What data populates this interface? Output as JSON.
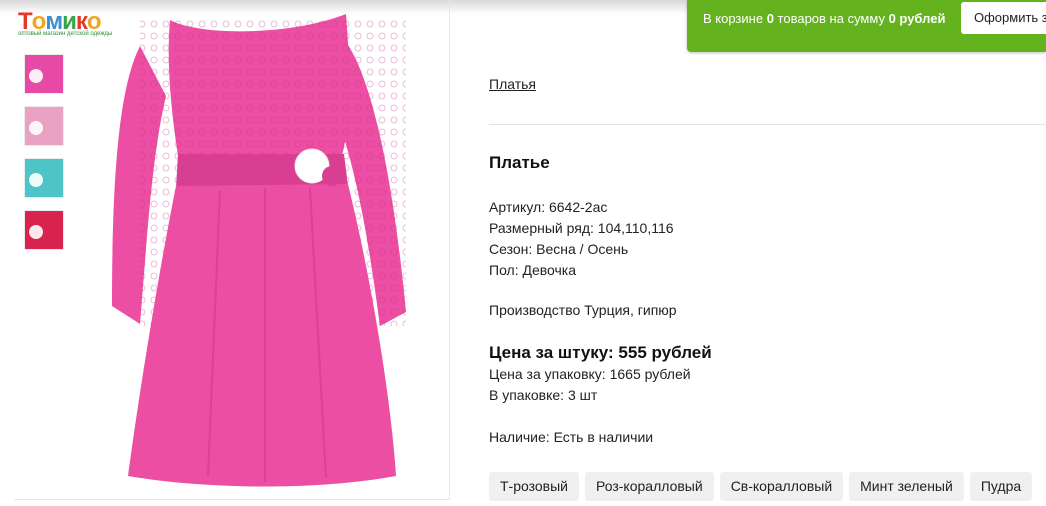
{
  "logo": {
    "letters": [
      "Т",
      "о",
      "м",
      "и",
      "к",
      "о"
    ],
    "letter_colors": [
      "#e23a2a",
      "#f2a51f",
      "#3c8fd0",
      "#38a44a",
      "#e23a2a",
      "#f2a51f"
    ],
    "tagline": "оптовый магазин детской одежды"
  },
  "gallery": {
    "thumbnail_colors": [
      "#e64aa5",
      "#e9a2c3",
      "#4fc4c7",
      "#d8234e"
    ],
    "main_color": "#ec4ea3",
    "main_shade": "#d83f93"
  },
  "cart": {
    "text_prefix": "В корзине",
    "items_count": "0",
    "text_middle": "товаров на сумму",
    "sum": "0 рублей",
    "checkout_label": "Оформить з",
    "bar_color": "#63b21e"
  },
  "breadcrumb": "Платья",
  "product": {
    "title": "Платье",
    "properties": [
      "Артикул: 6642-2ас",
      "Размерный ряд: 104,110,116",
      "Сезон: Весна / Осень",
      "Пол: Девочка"
    ],
    "origin": "Производство Турция, гипюр",
    "price_per_item": "Цена за штуку: 555 рублей",
    "price_per_pack": "Цена за упаковку: 1665 рублей",
    "pack_count": "В упаковке: 3 шт",
    "availability": "Наличие: Есть в наличии",
    "colors": [
      "Т-розовый",
      "Роз-коралловый",
      "Св-коралловый",
      "Минт зеленый",
      "Пудра"
    ]
  }
}
